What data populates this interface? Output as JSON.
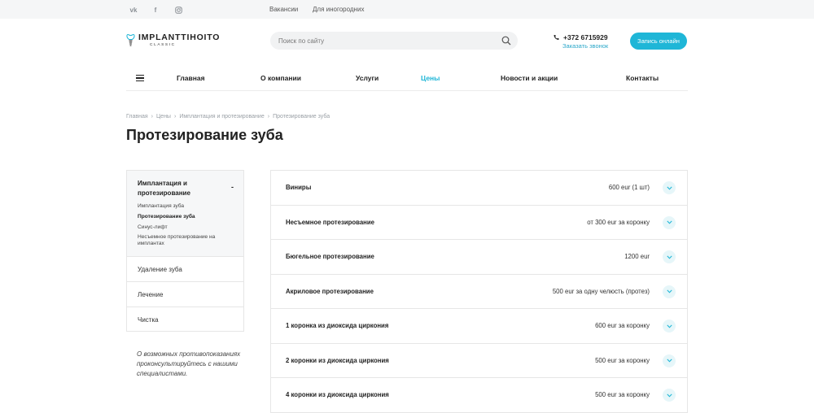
{
  "topbar": {
    "social": [
      {
        "icon": "vk-icon",
        "glyph": "vk"
      },
      {
        "icon": "facebook-icon",
        "glyph": "f"
      },
      {
        "icon": "instagram-icon",
        "glyph": ""
      }
    ],
    "links": [
      "Вакансии",
      "Для иногородних"
    ]
  },
  "header": {
    "logo_main": "IMPLANTTIHOITO",
    "logo_sub": "CLASSIC",
    "search_placeholder": "Поиск по сайту",
    "phone": "+372 6715929",
    "callback": "Заказать звонок",
    "signup": "Запись онлайн"
  },
  "nav": {
    "items": [
      "Главная",
      "О компании",
      "Услуги",
      "Цены",
      "Новости и акции",
      "Контакты"
    ],
    "active": "Цены"
  },
  "breadcrumb": [
    "Главная",
    "Цены",
    "Имплантация и протезирование",
    "Протезирование зуба"
  ],
  "page_title": "Протезирование зуба",
  "sidebar": {
    "active_group": "Имплантация и протезирование",
    "collapse_glyph": "-",
    "sub_items": [
      "Имплантация зуба",
      "Протезирование зуба",
      "Синус-лифт",
      "Несъемное протезирование на имплантах"
    ],
    "current_sub": "Протезирование зуба",
    "groups": [
      "Удаление зуба",
      "Лечение",
      "Чистка"
    ]
  },
  "note": "О возможных противопоказаниях проконсультируйтесь с нашими специалистами.",
  "prices": [
    {
      "name": "Виниры",
      "price": "600 eur (1 шт)"
    },
    {
      "name": "Несъемное протезирование",
      "price": "от 300 eur за коронку"
    },
    {
      "name": "Бюгельное протезирование",
      "price": "1200 eur"
    },
    {
      "name": "Акриловое протезирование",
      "price": "500 eur за одну челюсть (протез)"
    },
    {
      "name": "1 коронка из диоксида циркония",
      "price": "600 eur за коронку"
    },
    {
      "name": "2 коронки из диоксида циркония",
      "price": "500 eur за коронку"
    },
    {
      "name": "4 коронки из диоксида циркония",
      "price": "500 eur за коронку"
    }
  ],
  "colors": {
    "accent": "#1fb6d7",
    "link": "#2aa7c9",
    "toggle_bg": "#e6f6f9",
    "topbar_bg": "#f5f6f7"
  }
}
